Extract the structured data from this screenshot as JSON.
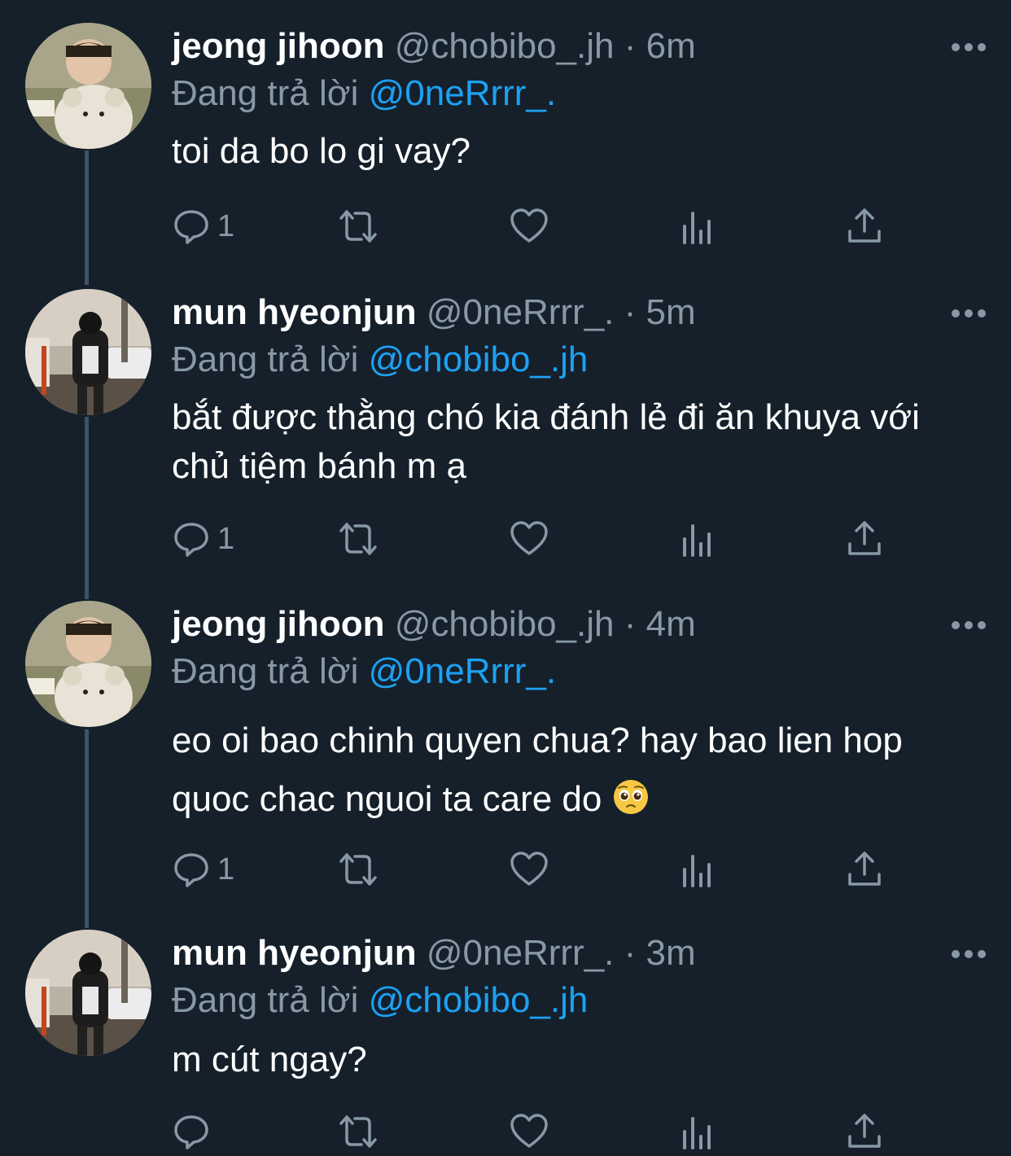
{
  "colors": {
    "background": "#15202b",
    "secondary_text": "#8899a6",
    "accent": "#1da1f2",
    "thread_line": "#3d5466"
  },
  "tweets": [
    {
      "display_name": "jeong jihoon",
      "handle": "@chobibo_.jh",
      "separator": "·",
      "time": "6m",
      "reply_prefix": "Đang trả lời",
      "reply_to": "@0neRrrr_.",
      "text": "toi da bo lo gi vay?",
      "reply_count": "1",
      "avatar": "baby-with-teddy-bear"
    },
    {
      "display_name": "mun hyeonjun",
      "handle": "@0neRrrr_.",
      "separator": "·",
      "time": "5m",
      "reply_prefix": "Đang trả lời",
      "reply_to": "@chobibo_.jh",
      "text": "bắt được thằng chó kia đánh lẻ đi ăn khuya với chủ tiệm bánh m ạ",
      "reply_count": "1",
      "avatar": "person-standing-outdoors"
    },
    {
      "display_name": "jeong jihoon",
      "handle": "@chobibo_.jh",
      "separator": "·",
      "time": "4m",
      "reply_prefix": "Đang trả lời",
      "reply_to": "@0neRrrr_.",
      "text": "eo oi bao chinh quyen chua? hay bao lien hop quoc chac nguoi ta care do",
      "emoji": "pleading-face-emoji",
      "reply_count": "1",
      "avatar": "baby-with-teddy-bear"
    },
    {
      "display_name": "mun hyeonjun",
      "handle": "@0neRrrr_.",
      "separator": "·",
      "time": "3m",
      "reply_prefix": "Đang trả lời",
      "reply_to": "@chobibo_.jh",
      "text": "m cút ngay?",
      "reply_count": "",
      "avatar": "person-standing-outdoors"
    }
  ],
  "icons": {
    "reply": "reply-icon",
    "retweet": "retweet-icon",
    "like": "like-icon",
    "analytics": "analytics-icon",
    "share": "share-icon",
    "more": "more-icon"
  }
}
